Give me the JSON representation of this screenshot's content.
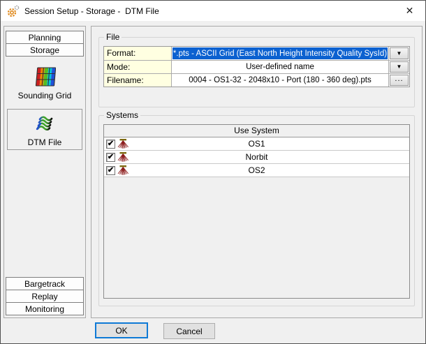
{
  "window": {
    "title": "Session Setup - Storage -  DTM File"
  },
  "icons": {
    "close": "✕",
    "dropdown_arrow": "▼",
    "check": "✔",
    "gear": "gears-icon",
    "sounding_grid": "color-grid-icon",
    "dtm_file": "wavy-lines-icon",
    "system": "multibeam-fan-icon"
  },
  "sidebar": {
    "top_buttons": [
      {
        "label": "Planning"
      },
      {
        "label": "Storage"
      }
    ],
    "items": [
      {
        "label": "Sounding Grid",
        "selected": false
      },
      {
        "label": "DTM File",
        "selected": true
      }
    ],
    "bottom_buttons": [
      {
        "label": "Bargetrack"
      },
      {
        "label": "Replay"
      },
      {
        "label": "Monitoring"
      }
    ]
  },
  "file_group": {
    "title": "File",
    "rows": [
      {
        "label": "Format:",
        "value": "*.pts - ASCII Grid (East North Height Intensity Quality SysId)",
        "control": "dropdown",
        "highlighted": true
      },
      {
        "label": "Mode:",
        "value": "User-defined name",
        "control": "dropdown",
        "highlighted": false
      },
      {
        "label": "Filename:",
        "value": "0004 - OS1-32 - 2048x10 - Port (180 - 360 deg).pts",
        "control": "browse",
        "browse_label": "..."
      }
    ]
  },
  "systems_group": {
    "title": "Systems",
    "table": {
      "header": "Use System",
      "rows": [
        {
          "name": "OS1",
          "checked": true
        },
        {
          "name": "Norbit",
          "checked": true
        },
        {
          "name": "OS2",
          "checked": true
        }
      ]
    }
  },
  "footer": {
    "ok_label": "OK",
    "cancel_label": "Cancel"
  },
  "colors": {
    "highlight": "#0b61d0",
    "label_cell": "#ffffe1",
    "titlebar": "#ffffff",
    "dialog_bg": "#f0f0f0",
    "fan_red": "#8b1a1a",
    "accent_orange": "#e08a1e"
  }
}
